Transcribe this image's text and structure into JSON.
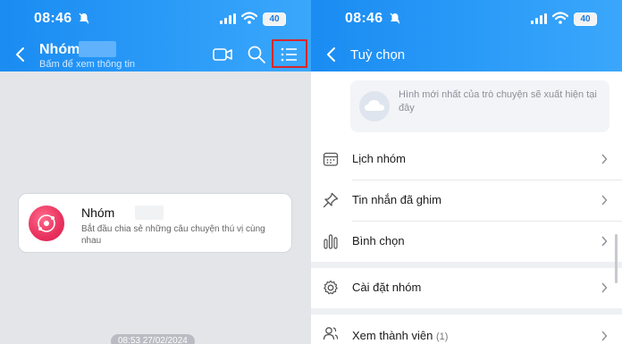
{
  "colors": {
    "header_gradient_start": "#1a8cf2",
    "header_gradient_end": "#3aa7fb",
    "highlight_border": "#d8262c",
    "avatar_accent": "#e8315e"
  },
  "left": {
    "status": {
      "time": "08:46",
      "battery": "40"
    },
    "header": {
      "title": "Nhóm",
      "subtitle": "Bấm để xem thông tin",
      "icons": [
        "back-icon",
        "video-call-icon",
        "search-icon",
        "list-menu-icon"
      ]
    },
    "card": {
      "title": "Nhóm",
      "text": "Bắt đầu chia sẻ những câu chuyện thú vị cùng nhau"
    },
    "timestamp": "08:53 27/02/2024"
  },
  "right": {
    "status": {
      "time": "08:46",
      "battery": "40"
    },
    "header": {
      "title": "Tuỳ chọn"
    },
    "media_placeholder": "Hình mới nhất của trò chuyện sẽ xuất hiện tại đây",
    "options": [
      {
        "label": "Lịch nhóm",
        "icon": "calendar-icon"
      },
      {
        "label": "Tin nhắn đã ghim",
        "icon": "pin-icon"
      },
      {
        "label": "Bình chọn",
        "icon": "poll-icon"
      },
      {
        "label": "Cài đặt nhóm",
        "icon": "gear-icon"
      },
      {
        "label": "Xem thành viên",
        "count": "(1)",
        "icon": "members-icon"
      }
    ]
  }
}
